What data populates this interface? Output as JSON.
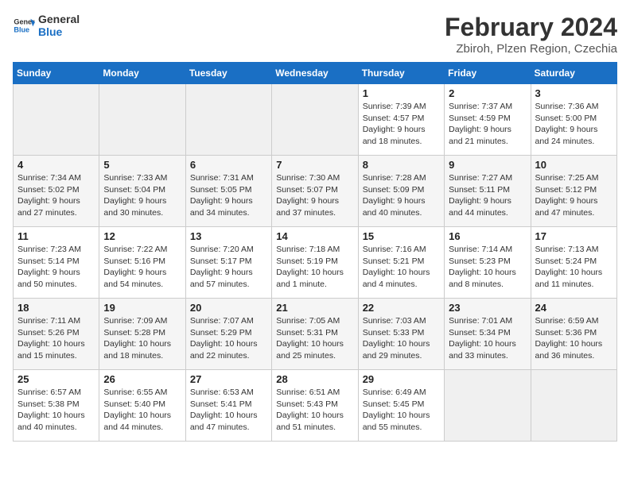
{
  "header": {
    "logo_text_general": "General",
    "logo_text_blue": "Blue",
    "title": "February 2024",
    "subtitle": "Zbiroh, Plzen Region, Czechia"
  },
  "weekdays": [
    "Sunday",
    "Monday",
    "Tuesday",
    "Wednesday",
    "Thursday",
    "Friday",
    "Saturday"
  ],
  "weeks": [
    [
      {
        "day": "",
        "info": ""
      },
      {
        "day": "",
        "info": ""
      },
      {
        "day": "",
        "info": ""
      },
      {
        "day": "",
        "info": ""
      },
      {
        "day": "1",
        "info": "Sunrise: 7:39 AM\nSunset: 4:57 PM\nDaylight: 9 hours\nand 18 minutes."
      },
      {
        "day": "2",
        "info": "Sunrise: 7:37 AM\nSunset: 4:59 PM\nDaylight: 9 hours\nand 21 minutes."
      },
      {
        "day": "3",
        "info": "Sunrise: 7:36 AM\nSunset: 5:00 PM\nDaylight: 9 hours\nand 24 minutes."
      }
    ],
    [
      {
        "day": "4",
        "info": "Sunrise: 7:34 AM\nSunset: 5:02 PM\nDaylight: 9 hours\nand 27 minutes."
      },
      {
        "day": "5",
        "info": "Sunrise: 7:33 AM\nSunset: 5:04 PM\nDaylight: 9 hours\nand 30 minutes."
      },
      {
        "day": "6",
        "info": "Sunrise: 7:31 AM\nSunset: 5:05 PM\nDaylight: 9 hours\nand 34 minutes."
      },
      {
        "day": "7",
        "info": "Sunrise: 7:30 AM\nSunset: 5:07 PM\nDaylight: 9 hours\nand 37 minutes."
      },
      {
        "day": "8",
        "info": "Sunrise: 7:28 AM\nSunset: 5:09 PM\nDaylight: 9 hours\nand 40 minutes."
      },
      {
        "day": "9",
        "info": "Sunrise: 7:27 AM\nSunset: 5:11 PM\nDaylight: 9 hours\nand 44 minutes."
      },
      {
        "day": "10",
        "info": "Sunrise: 7:25 AM\nSunset: 5:12 PM\nDaylight: 9 hours\nand 47 minutes."
      }
    ],
    [
      {
        "day": "11",
        "info": "Sunrise: 7:23 AM\nSunset: 5:14 PM\nDaylight: 9 hours\nand 50 minutes."
      },
      {
        "day": "12",
        "info": "Sunrise: 7:22 AM\nSunset: 5:16 PM\nDaylight: 9 hours\nand 54 minutes."
      },
      {
        "day": "13",
        "info": "Sunrise: 7:20 AM\nSunset: 5:17 PM\nDaylight: 9 hours\nand 57 minutes."
      },
      {
        "day": "14",
        "info": "Sunrise: 7:18 AM\nSunset: 5:19 PM\nDaylight: 10 hours\nand 1 minute."
      },
      {
        "day": "15",
        "info": "Sunrise: 7:16 AM\nSunset: 5:21 PM\nDaylight: 10 hours\nand 4 minutes."
      },
      {
        "day": "16",
        "info": "Sunrise: 7:14 AM\nSunset: 5:23 PM\nDaylight: 10 hours\nand 8 minutes."
      },
      {
        "day": "17",
        "info": "Sunrise: 7:13 AM\nSunset: 5:24 PM\nDaylight: 10 hours\nand 11 minutes."
      }
    ],
    [
      {
        "day": "18",
        "info": "Sunrise: 7:11 AM\nSunset: 5:26 PM\nDaylight: 10 hours\nand 15 minutes."
      },
      {
        "day": "19",
        "info": "Sunrise: 7:09 AM\nSunset: 5:28 PM\nDaylight: 10 hours\nand 18 minutes."
      },
      {
        "day": "20",
        "info": "Sunrise: 7:07 AM\nSunset: 5:29 PM\nDaylight: 10 hours\nand 22 minutes."
      },
      {
        "day": "21",
        "info": "Sunrise: 7:05 AM\nSunset: 5:31 PM\nDaylight: 10 hours\nand 25 minutes."
      },
      {
        "day": "22",
        "info": "Sunrise: 7:03 AM\nSunset: 5:33 PM\nDaylight: 10 hours\nand 29 minutes."
      },
      {
        "day": "23",
        "info": "Sunrise: 7:01 AM\nSunset: 5:34 PM\nDaylight: 10 hours\nand 33 minutes."
      },
      {
        "day": "24",
        "info": "Sunrise: 6:59 AM\nSunset: 5:36 PM\nDaylight: 10 hours\nand 36 minutes."
      }
    ],
    [
      {
        "day": "25",
        "info": "Sunrise: 6:57 AM\nSunset: 5:38 PM\nDaylight: 10 hours\nand 40 minutes."
      },
      {
        "day": "26",
        "info": "Sunrise: 6:55 AM\nSunset: 5:40 PM\nDaylight: 10 hours\nand 44 minutes."
      },
      {
        "day": "27",
        "info": "Sunrise: 6:53 AM\nSunset: 5:41 PM\nDaylight: 10 hours\nand 47 minutes."
      },
      {
        "day": "28",
        "info": "Sunrise: 6:51 AM\nSunset: 5:43 PM\nDaylight: 10 hours\nand 51 minutes."
      },
      {
        "day": "29",
        "info": "Sunrise: 6:49 AM\nSunset: 5:45 PM\nDaylight: 10 hours\nand 55 minutes."
      },
      {
        "day": "",
        "info": ""
      },
      {
        "day": "",
        "info": ""
      }
    ]
  ]
}
